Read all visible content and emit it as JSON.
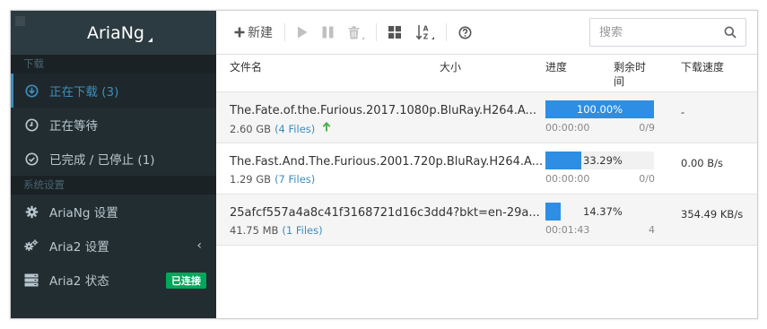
{
  "app": {
    "logo": "AriaNg"
  },
  "sidebar": {
    "sections": [
      {
        "title": "下载"
      },
      {
        "title": "系统设置"
      }
    ],
    "downloads": [
      {
        "label": "正在下载 (3)",
        "icon": "download-circle-icon",
        "active": true
      },
      {
        "label": "正在等待",
        "icon": "clock-icon",
        "active": false
      },
      {
        "label": "已完成 / 已停止 (1)",
        "icon": "check-circle-icon",
        "active": false
      }
    ],
    "settings": [
      {
        "label": "AriaNg 设置",
        "icon": "gear-icon"
      },
      {
        "label": "Aria2 设置",
        "icon": "gears-icon",
        "chevron": "‹"
      },
      {
        "label": "Aria2 状态",
        "icon": "server-icon",
        "badge": "已连接"
      }
    ]
  },
  "toolbar": {
    "new_label": "新建",
    "search_placeholder": "搜索"
  },
  "table": {
    "headers": {
      "name": "文件名",
      "size": "大小",
      "progress": "进度",
      "remaining_line1": "剩余时",
      "remaining_line2": "间",
      "speed": "下载速度"
    },
    "rows": [
      {
        "name": "The.Fate.of.the.Furious.2017.1080p.BluRay.H264.A...",
        "size": "2.60 GB",
        "files": "(4 Files)",
        "progress": 100.0,
        "progress_text": "100.00%",
        "time": "00:00:00",
        "connections": "0/9",
        "speed": "-",
        "seeding": true
      },
      {
        "name": "The.Fast.And.The.Furious.2001.720p.BluRay.H264.A...",
        "size": "1.29 GB",
        "files": "(7 Files)",
        "progress": 33.29,
        "progress_text": "33.29%",
        "time": "00:00:00",
        "connections": "0/0",
        "speed": "0.00 B/s",
        "seeding": false
      },
      {
        "name": "25afcf557a4a8c41f3168721d16c3dd4?bkt=en-29a...",
        "size": "41.75 MB",
        "files": "(1 Files)",
        "progress": 14.37,
        "progress_text": "14.37%",
        "time": "00:01:43",
        "connections": "4",
        "speed": "354.49 KB/s",
        "seeding": false
      }
    ]
  },
  "colors": {
    "sidebar_bg": "#222d32",
    "accent": "#3c8dbc",
    "progress": "#2d8ee3",
    "badge": "#00a65a"
  }
}
